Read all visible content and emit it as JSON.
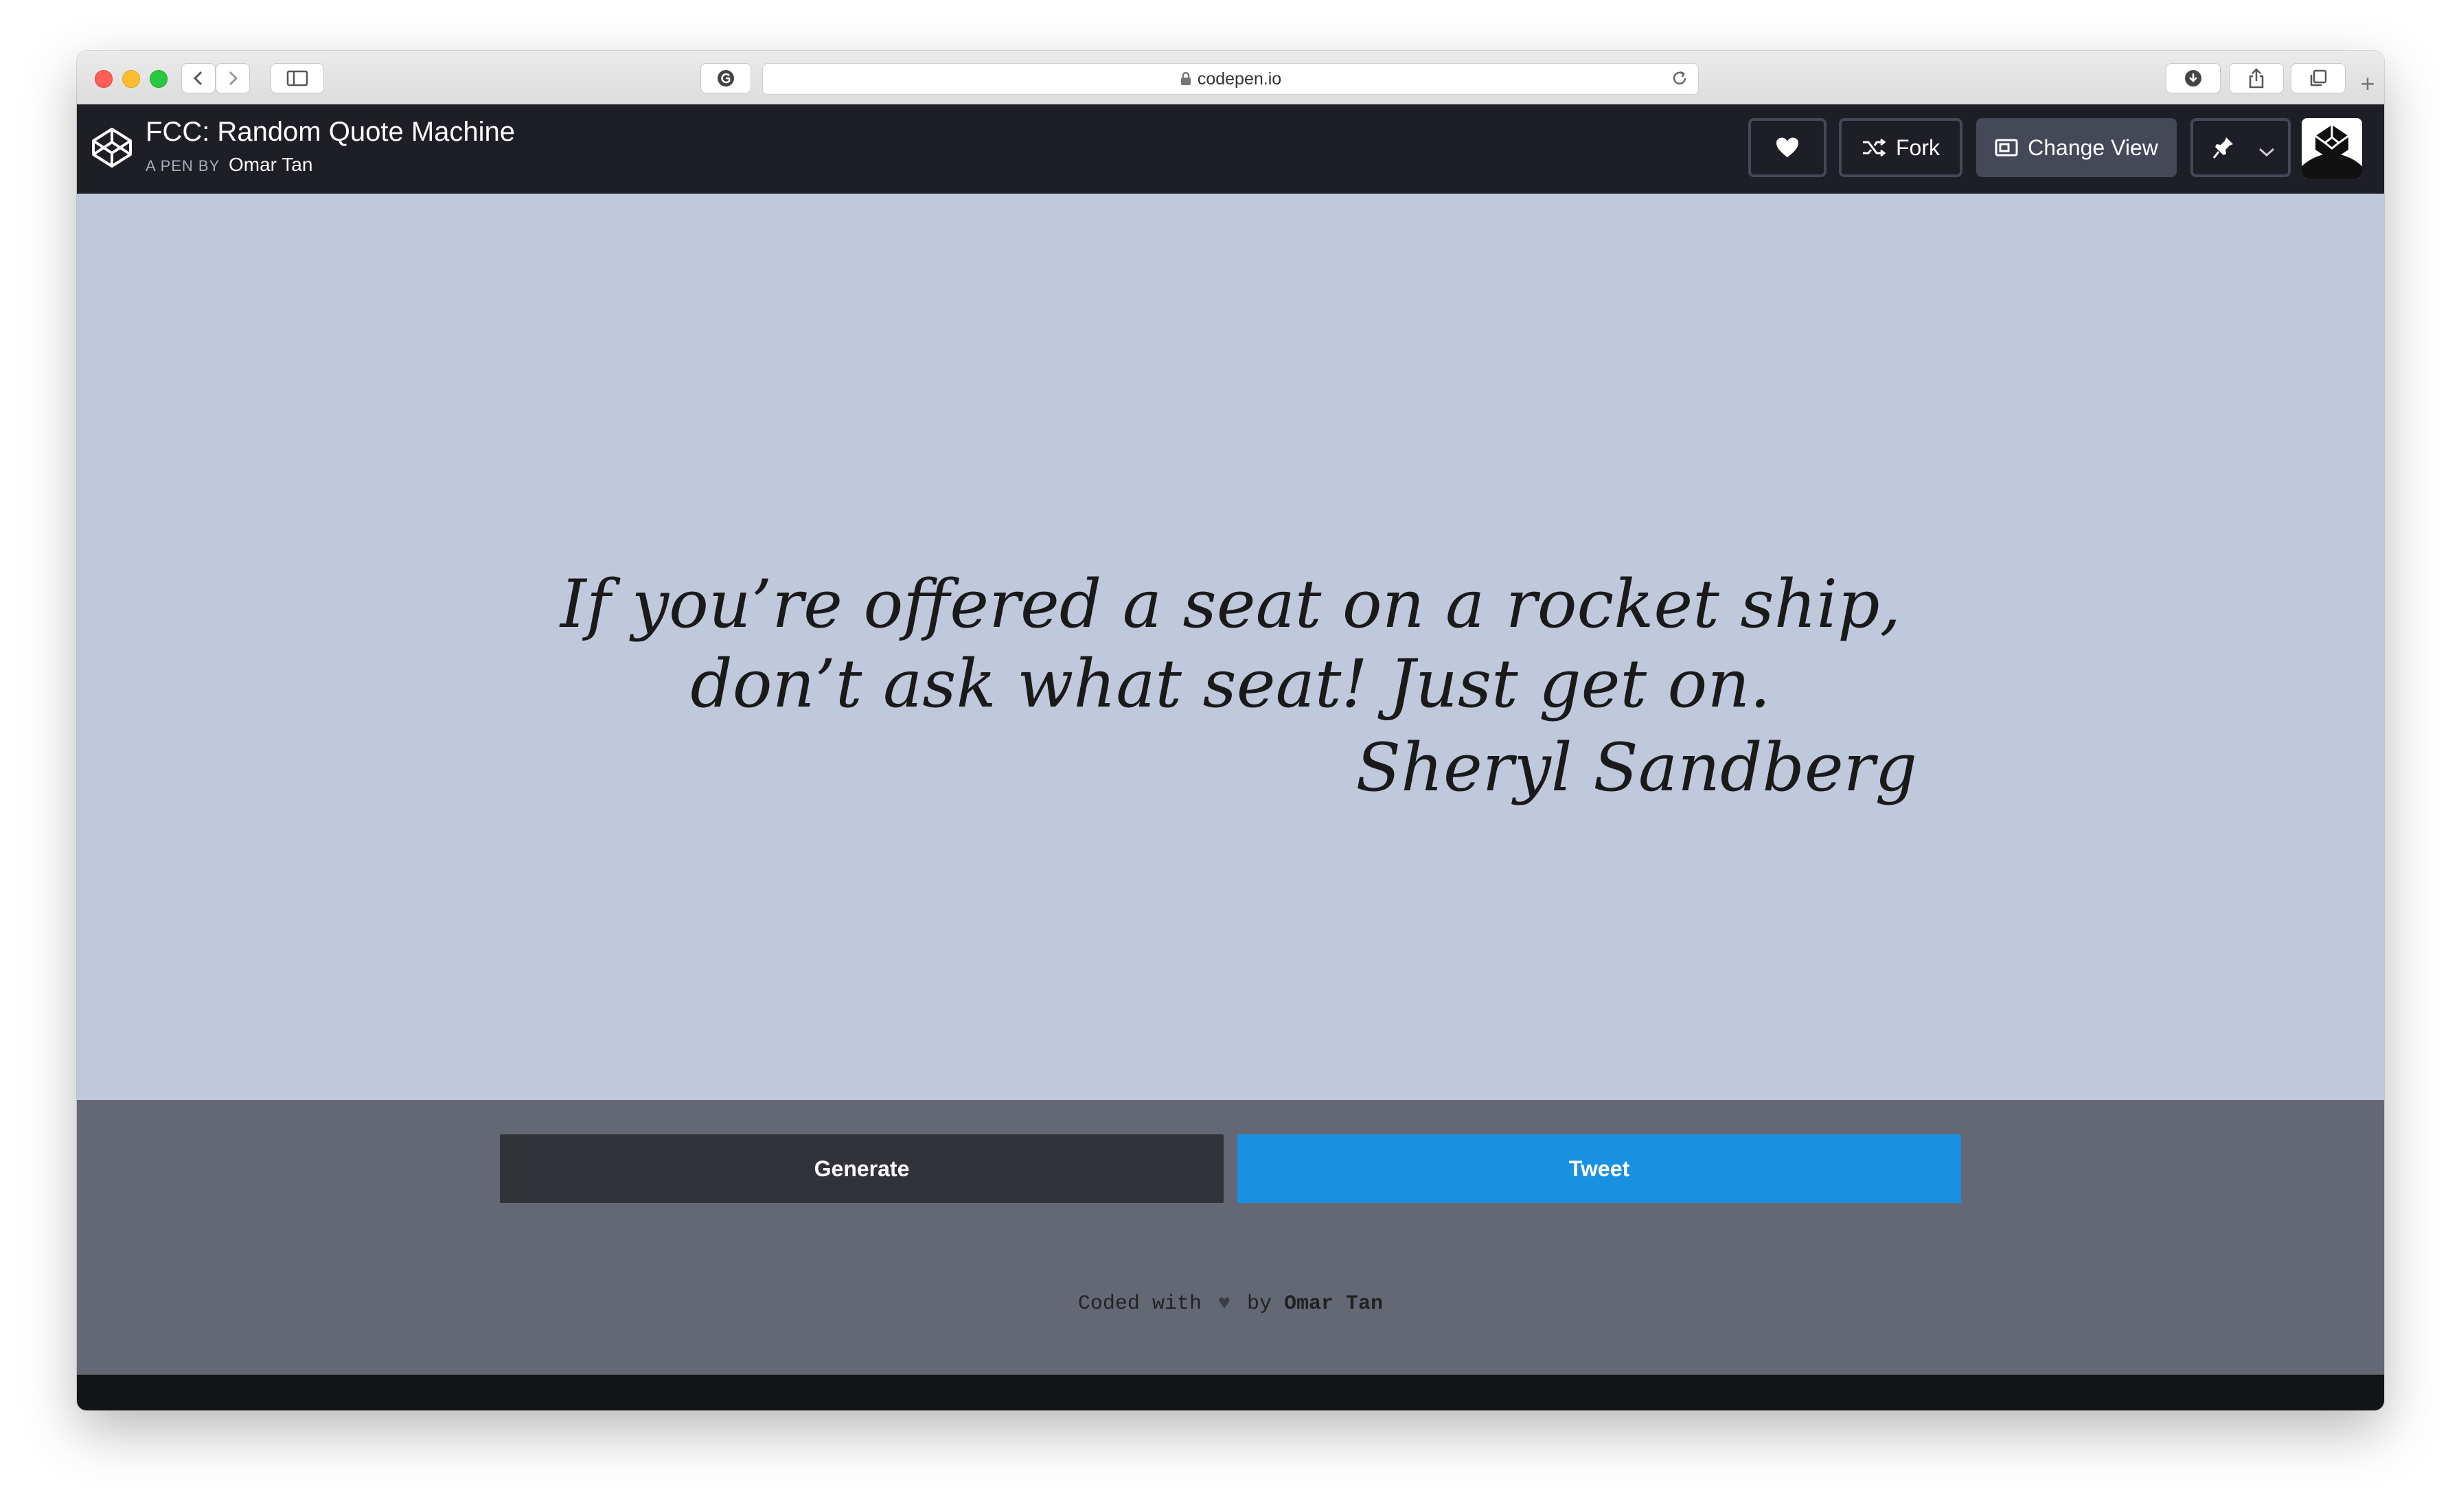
{
  "browser": {
    "url": "codepen.io"
  },
  "header": {
    "title": "FCC: Random Quote Machine",
    "byline_prefix": "A PEN BY",
    "author": "Omar Tan",
    "fork_label": "Fork",
    "change_view_label": "Change View"
  },
  "quote": {
    "text": "If you’re offered a seat on a rocket ship, don’t ask what seat! Just get on.",
    "author": "Sheryl Sandberg"
  },
  "controls": {
    "generate_label": "Generate",
    "tweet_label": "Tweet"
  },
  "footer": {
    "prefix": "Coded with",
    "heart": "♥",
    "by": "by",
    "author": "Omar Tan"
  },
  "colors": {
    "header_bg": "#1e1f26",
    "quote_bg": "#c0c9dc",
    "controls_bg": "#636874",
    "generate_bg": "#323338",
    "tweet_bg": "#1a91e0"
  }
}
